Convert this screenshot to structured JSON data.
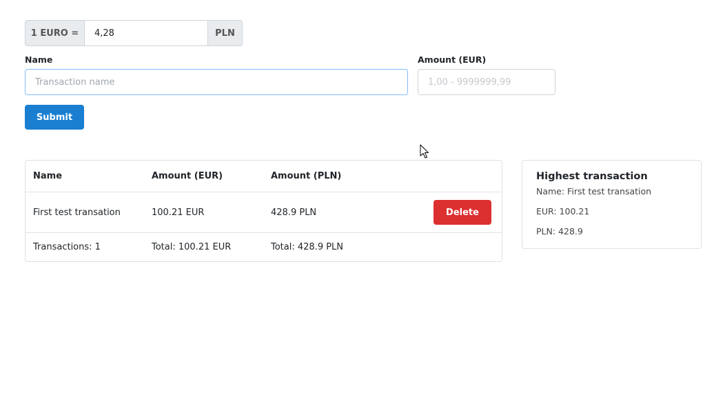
{
  "rate": {
    "prefix": "1 EURO =",
    "value": "4,28",
    "suffix": "PLN"
  },
  "form": {
    "name_label": "Name",
    "name_placeholder": "Transaction name",
    "amount_label": "Amount (EUR)",
    "amount_placeholder": "1,00 - 9999999,99",
    "submit_label": "Submit"
  },
  "table": {
    "headers": [
      "Name",
      "Amount (EUR)",
      "Amount (PLN)"
    ],
    "rows": [
      {
        "name": "First test transation",
        "eur": "100.21 EUR",
        "pln": "428.9 PLN",
        "delete_label": "Delete"
      }
    ],
    "footer": {
      "count": "Transactions: 1",
      "total_eur": "Total: 100.21 EUR",
      "total_pln": "Total: 428.9 PLN"
    }
  },
  "highest": {
    "title": "Highest transaction",
    "name": "Name: First test transation",
    "eur": "EUR: 100.21",
    "pln": "PLN: 428.9"
  },
  "colors": {
    "submit": "#1a7fd1",
    "delete": "#dc2f2f",
    "focus_border": "#80bdff"
  },
  "icons": {
    "cursor": "mouse-pointer-icon"
  }
}
